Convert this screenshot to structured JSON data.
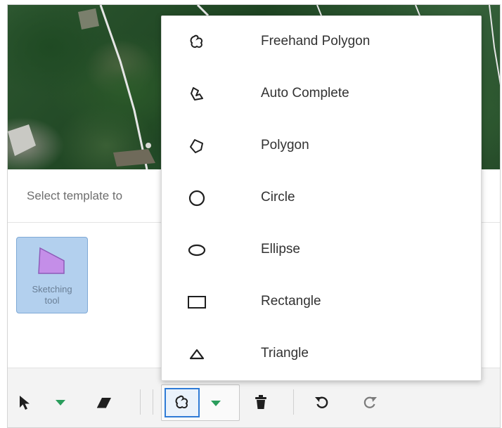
{
  "hint": {
    "text": "Select template to"
  },
  "template": {
    "label": "Sketching\ntool",
    "fill_color": "#c48ee8"
  },
  "toolbar": {
    "items": [
      {
        "name": "select-arrow-icon"
      },
      {
        "name": "select-dropdown-caret"
      },
      {
        "name": "eraser-icon"
      },
      {
        "name": "freehand-polygon-icon"
      },
      {
        "name": "draw-dropdown-caret"
      },
      {
        "name": "trash-icon"
      },
      {
        "name": "undo-icon"
      },
      {
        "name": "redo-icon"
      }
    ],
    "caret_color": "#2a9d5c",
    "active_color": "#2f7bd6"
  },
  "menu": {
    "items": [
      {
        "label": "Freehand Polygon",
        "icon": "freehand-polygon-icon"
      },
      {
        "label": "Auto Complete",
        "icon": "auto-complete-icon"
      },
      {
        "label": "Polygon",
        "icon": "polygon-icon"
      },
      {
        "label": "Circle",
        "icon": "circle-icon"
      },
      {
        "label": "Ellipse",
        "icon": "ellipse-icon"
      },
      {
        "label": "Rectangle",
        "icon": "rectangle-icon"
      },
      {
        "label": "Triangle",
        "icon": "triangle-icon"
      }
    ]
  }
}
